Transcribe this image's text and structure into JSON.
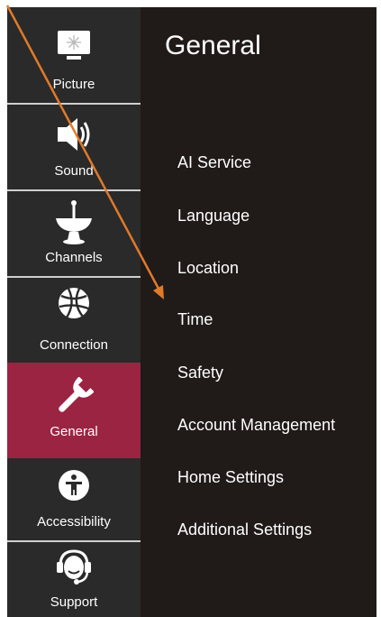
{
  "sidebar": {
    "items": [
      {
        "label": "Picture",
        "icon": "picture-icon"
      },
      {
        "label": "Sound",
        "icon": "speaker-icon"
      },
      {
        "label": "Channels",
        "icon": "satellite-dish-icon"
      },
      {
        "label": "Connection",
        "icon": "globe-network-icon"
      },
      {
        "label": "General",
        "icon": "wrench-icon",
        "selected": true
      },
      {
        "label": "Accessibility",
        "icon": "accessibility-icon"
      },
      {
        "label": "Support",
        "icon": "headset-support-icon"
      }
    ]
  },
  "panel": {
    "title": "General",
    "items": [
      "AI Service",
      "Language",
      "Location",
      "Time",
      "Safety",
      "Account Management",
      "Home Settings",
      "Additional Settings"
    ]
  },
  "colors": {
    "screen_background": "#201a19",
    "sidebar_background": "#2a2a2a",
    "selected_background": "#9b2442",
    "annotation_arrow": "#e07a2a"
  }
}
